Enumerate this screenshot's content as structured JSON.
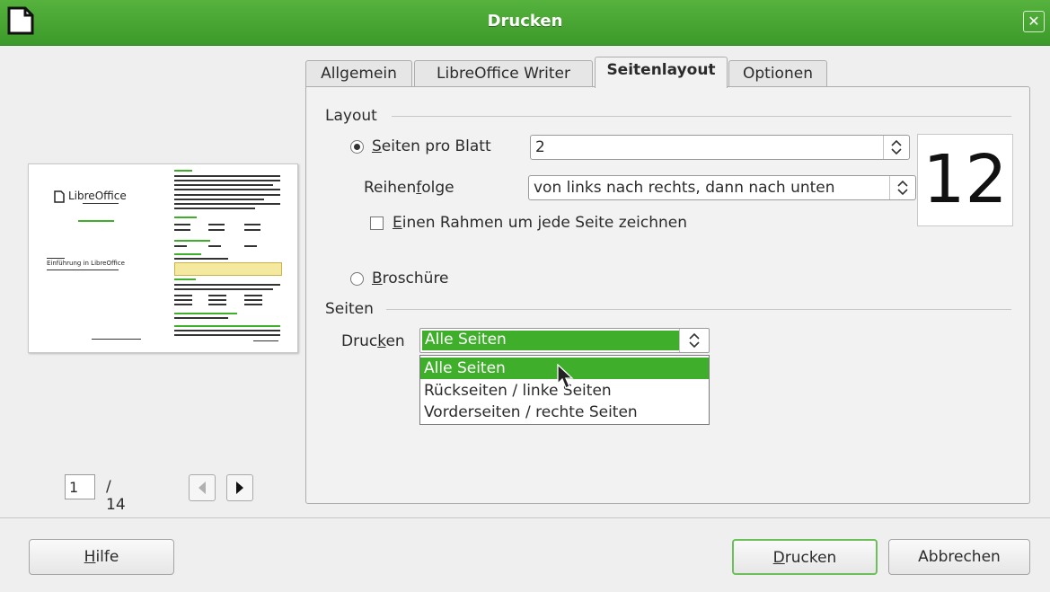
{
  "window": {
    "title": "Drucken",
    "close_icon": "close-icon"
  },
  "preview": {
    "page_current": "1",
    "page_total": "/ 14",
    "logo_text": "LibreOffice",
    "doc_title": "Einführung in LibreOffice"
  },
  "tabs": [
    {
      "label": "Allgemein",
      "active": false
    },
    {
      "label": "LibreOffice Writer",
      "active": false
    },
    {
      "label": "Seitenlayout",
      "active": true
    },
    {
      "label": "Optionen",
      "active": false
    }
  ],
  "layout": {
    "section_label": "Layout",
    "pages_per_sheet": {
      "label_mnemonic": "S",
      "label_rest": "eiten pro Blatt",
      "value": "2",
      "selected": true
    },
    "order": {
      "label_pre": "Reihen",
      "label_mnemonic": "f",
      "label_post": "olge",
      "value": "von links nach rechts, dann nach unten"
    },
    "border": {
      "label_mnemonic": "E",
      "label_rest": "inen Rahmen um jede Seite zeichnen",
      "checked": false
    },
    "brochure": {
      "label_mnemonic": "B",
      "label_rest": "roschüre",
      "selected": false
    },
    "preview_number": "12"
  },
  "pages": {
    "section_label": "Seiten",
    "print": {
      "label_pre": "Druc",
      "label_mnemonic": "k",
      "label_post": "en",
      "value": "Alle Seiten"
    },
    "options": [
      "Alle Seiten",
      "Rückseiten / linke Seiten",
      "Vorderseiten / rechte Seiten"
    ]
  },
  "buttons": {
    "help_mnemonic": "H",
    "help_rest": "ilfe",
    "print_mnemonic": "D",
    "print_rest": "rucken",
    "cancel": "Abbrechen"
  },
  "colors": {
    "accent": "#3fae2a",
    "titlebar": "#4aa835"
  }
}
